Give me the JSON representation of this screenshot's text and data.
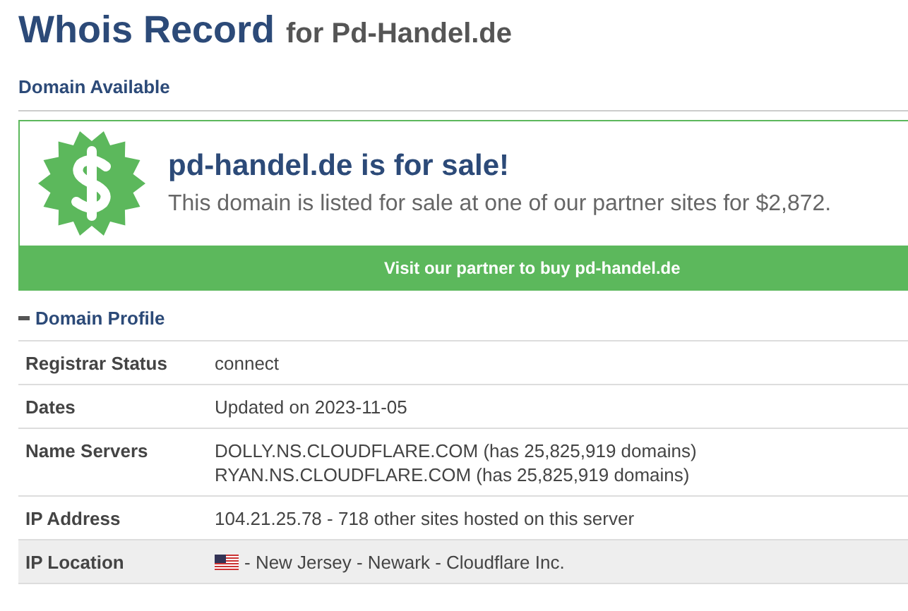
{
  "title": {
    "main": "Whois Record",
    "sub": "for Pd-Handel.de"
  },
  "availability": {
    "heading": "Domain Available"
  },
  "sale": {
    "headline": "pd-handel.de is for sale!",
    "text": "This domain is listed for sale at one of our partner sites for $2,872.",
    "button": "Visit our partner to buy pd-handel.de"
  },
  "profile": {
    "heading": "Domain Profile",
    "expanded": true,
    "rows": [
      {
        "label": "Registrar Status",
        "lines": [
          "connect"
        ],
        "shaded": false
      },
      {
        "label": "Dates",
        "lines": [
          "Updated on 2023-11-05"
        ],
        "shaded": false
      },
      {
        "label": "Name Servers",
        "lines": [
          "DOLLY.NS.CLOUDFLARE.COM (has 25,825,919 domains)",
          "RYAN.NS.CLOUDFLARE.COM (has 25,825,919 domains)"
        ],
        "shaded": false
      },
      {
        "label": "IP Address",
        "lines": [
          "104.21.25.78 - 718 other sites hosted on this server"
        ],
        "shaded": false
      },
      {
        "label": "IP Location",
        "kind": "flag",
        "lines": [
          "- New Jersey - Newark - Cloudflare Inc."
        ],
        "shaded": true
      }
    ]
  }
}
